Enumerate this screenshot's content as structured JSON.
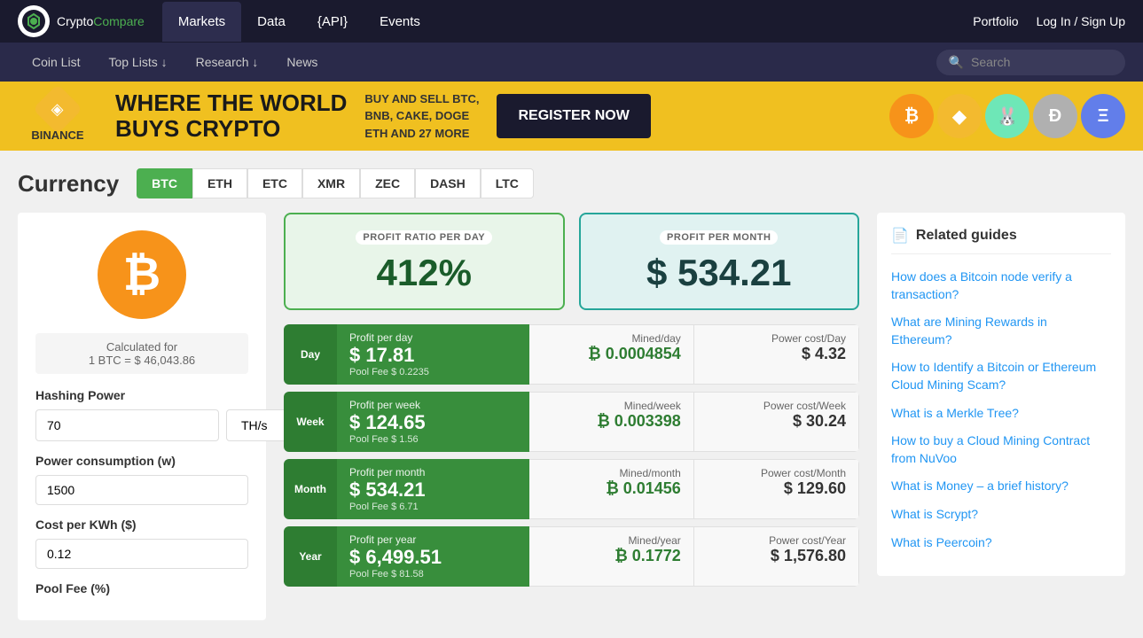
{
  "logo": {
    "text_crypto": "Crypto",
    "text_compare": "Compare"
  },
  "top_nav": {
    "links": [
      {
        "label": "Markets",
        "active": true
      },
      {
        "label": "Data"
      },
      {
        "label": "{API}"
      },
      {
        "label": "Events"
      }
    ],
    "portfolio": "Portfolio",
    "login": "Log In / Sign Up"
  },
  "secondary_nav": {
    "links": [
      {
        "label": "Coin List"
      },
      {
        "label": "Top Lists ↓"
      },
      {
        "label": "Research ↓"
      },
      {
        "label": "News"
      }
    ],
    "search_placeholder": "Search"
  },
  "banner": {
    "logo_text": "BINANCE",
    "title_line1": "WHERE THE WORLD",
    "title_line2": "BUYS CRYPTO",
    "desc": "BUY AND SELL BTC,\nBNB, CAKE, DOGE\nETH AND 27 MORE",
    "cta": "REGISTER NOW"
  },
  "page": {
    "currency_title": "Currency",
    "tabs": [
      "BTC",
      "ETH",
      "ETC",
      "XMR",
      "ZEC",
      "DASH",
      "LTC"
    ],
    "active_tab": "BTC"
  },
  "calculator": {
    "btc_symbol": "₿",
    "calc_label": "Calculated for",
    "btc_rate": "1 BTC = $ 46,043.86",
    "hashing_label": "Hashing Power",
    "hashing_value": "70",
    "hashing_unit": "TH/s",
    "power_label": "Power consumption (w)",
    "power_value": "1500",
    "cost_label": "Cost per KWh ($)",
    "cost_value": "0.12",
    "pool_label": "Pool Fee (%)"
  },
  "profit_summary": {
    "day_label": "PROFIT RATIO PER DAY",
    "day_value": "412%",
    "month_label": "PROFIT PER MONTH",
    "month_value": "$ 534.21"
  },
  "profit_rows": [
    {
      "period_short": "Day",
      "profit_title": "Profit per day",
      "profit_value": "$ 17.81",
      "pool_fee": "Pool Fee $ 0.2235",
      "mined_label": "Mined/day",
      "mined_value": "₿ 0.0004854",
      "power_label": "Power cost/Day",
      "power_value": "$ 4.32"
    },
    {
      "period_short": "Week",
      "profit_title": "Profit per week",
      "profit_value": "$ 124.65",
      "pool_fee": "Pool Fee $ 1.56",
      "mined_label": "Mined/week",
      "mined_value": "₿ 0.003398",
      "power_label": "Power cost/Week",
      "power_value": "$ 30.24"
    },
    {
      "period_short": "Month",
      "profit_title": "Profit per month",
      "profit_value": "$ 534.21",
      "pool_fee": "Pool Fee $ 6.71",
      "mined_label": "Mined/month",
      "mined_value": "₿ 0.01456",
      "power_label": "Power cost/Month",
      "power_value": "$ 129.60"
    },
    {
      "period_short": "Year",
      "profit_title": "Profit per year",
      "profit_value": "$ 6,499.51",
      "pool_fee": "Pool Fee $ 81.58",
      "mined_label": "Mined/year",
      "mined_value": "₿ 0.1772",
      "power_label": "Power cost/Year",
      "power_value": "$ 1,576.80"
    }
  ],
  "related_guides": {
    "title": "Related guides",
    "guides": [
      {
        "text": "How does a Bitcoin node verify a transaction?",
        "link": true
      },
      {
        "text": "What are Mining Rewards in Ethereum?",
        "link": true
      },
      {
        "text": "How to Identify a Bitcoin or Ethereum Cloud Mining Scam?",
        "link": true
      },
      {
        "text": "What is a Merkle Tree?",
        "link": true
      },
      {
        "text": "How to buy a Cloud Mining Contract from NuVoo",
        "link": true
      },
      {
        "text": "What is Money – a brief history?",
        "link": true
      },
      {
        "text": "What is Scrypt?",
        "link": true
      },
      {
        "text": "What is Peercoin?",
        "link": true
      }
    ]
  },
  "coins": [
    "₿",
    "♦",
    "🐰",
    "◉",
    "⟡"
  ]
}
